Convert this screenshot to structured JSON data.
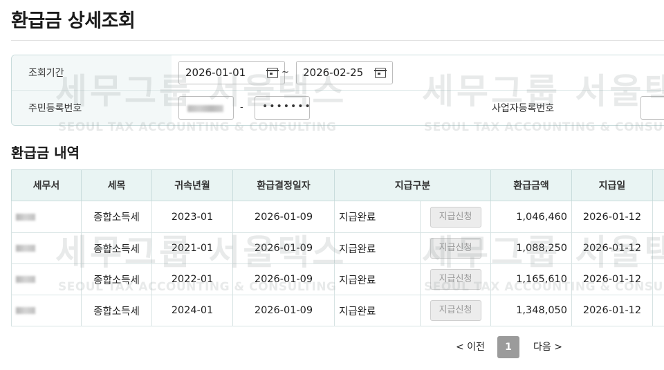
{
  "page": {
    "title": "환급금 상세조회",
    "section_title": "환급금 내역"
  },
  "search": {
    "period_label": "조회기간",
    "start_date": "2026-01-01",
    "end_date": "2026-02-25",
    "date_separator": "~",
    "resident_label": "주민등록번호",
    "resident_separator": "-",
    "resident_back": "•••••••",
    "business_label": "사업자등록번호"
  },
  "table": {
    "headers": [
      "세무서",
      "세목",
      "귀속년월",
      "환급결정일자",
      "지급구분",
      "환급금액",
      "지급일"
    ],
    "rows": [
      {
        "tax_item": "종합소득세",
        "period": "2023-01",
        "decision_date": "2026-01-09",
        "status": "지급완료",
        "action": "지급신청",
        "amount": "1,046,460",
        "pay_date": "2026-01-12"
      },
      {
        "tax_item": "종합소득세",
        "period": "2021-01",
        "decision_date": "2026-01-09",
        "status": "지급완료",
        "action": "지급신청",
        "amount": "1,088,250",
        "pay_date": "2026-01-12"
      },
      {
        "tax_item": "종합소득세",
        "period": "2022-01",
        "decision_date": "2026-01-09",
        "status": "지급완료",
        "action": "지급신청",
        "amount": "1,165,610",
        "pay_date": "2026-01-12"
      },
      {
        "tax_item": "종합소득세",
        "period": "2024-01",
        "decision_date": "2026-01-09",
        "status": "지급완료",
        "action": "지급신청",
        "amount": "1,348,050",
        "pay_date": "2026-01-12"
      }
    ]
  },
  "pagination": {
    "prev": "< 이전",
    "current": "1",
    "next": "다음 >"
  },
  "watermark": {
    "main": "세무그룹 서울택스",
    "sub": "SEOUL TAX ACCOUNTING & CONSULTING"
  },
  "icons": {
    "date_picker": "calendar-icon"
  },
  "colors": {
    "header_bg": "#e9f4f3",
    "border": "#c9dcdc",
    "active_page": "#9b9b9b"
  }
}
